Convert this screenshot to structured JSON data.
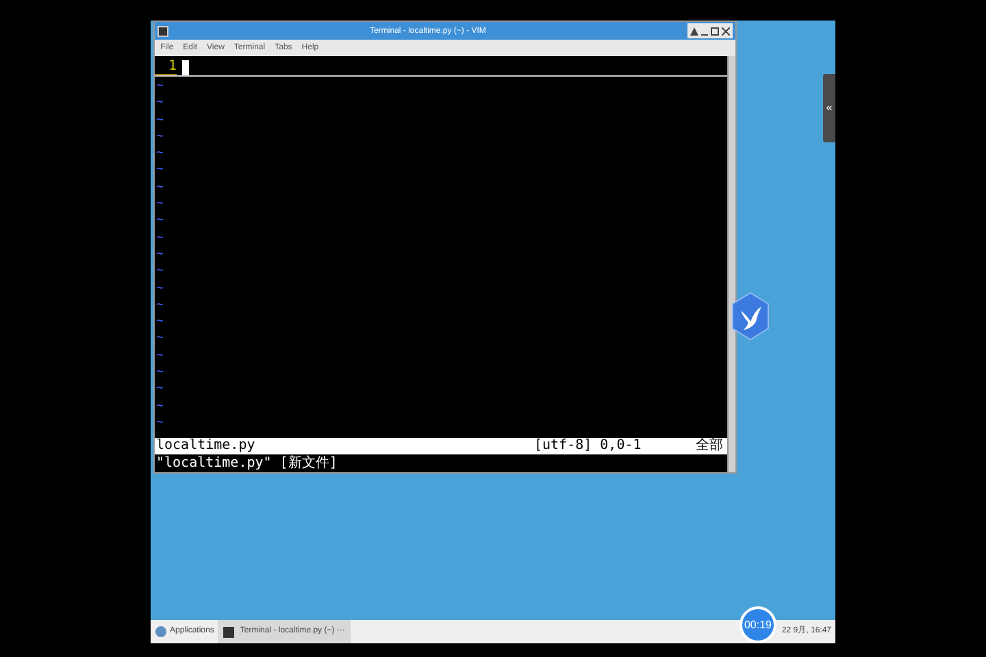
{
  "window": {
    "title": "Terminal - localtime.py (~) - VIM",
    "menu": [
      "File",
      "Edit",
      "View",
      "Terminal",
      "Tabs",
      "Help"
    ]
  },
  "vim": {
    "line_number": "1",
    "tildes": [
      "~",
      "~",
      "~",
      "~",
      "~",
      "~",
      "~",
      "~",
      "~",
      "~",
      "~",
      "~",
      "~",
      "~",
      "~",
      "~",
      "~",
      "~",
      "~",
      "~",
      "~"
    ],
    "status_line": {
      "file": "localtime.py",
      "position": "[utf-8] 0,0-1",
      "scroll": "全部"
    },
    "message": "\"localtime.py\" [新文件]"
  },
  "side_tab": {
    "label": "«"
  },
  "timer": "00:19",
  "taskbar": {
    "start": "Applications",
    "tasks": [
      {
        "label": "Terminal - localtime.py (~) ···",
        "selected": true
      }
    ],
    "clock": "22 9月, 16:47"
  }
}
